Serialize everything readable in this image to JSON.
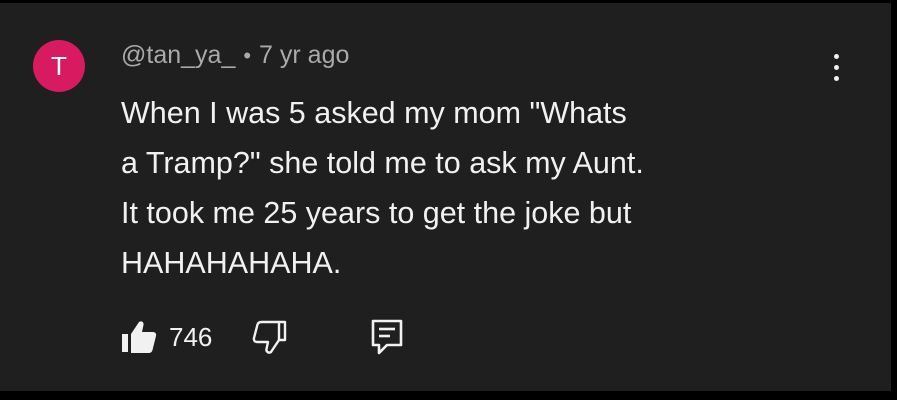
{
  "comment": {
    "avatar_letter": "T",
    "avatar_color": "#d81b60",
    "author": "@tan_ya_",
    "separator": "•",
    "time": "7 yr ago",
    "text_lines": [
      "When I was 5 asked my mom \"Whats",
      "a Tramp?\" she told me to ask my Aunt.",
      "It took me 25 years to get the joke but",
      "HAHAHAHAHA."
    ],
    "like_count": "746",
    "icons": {
      "like": "thumbs-up-icon",
      "dislike": "thumbs-down-icon",
      "reply": "reply-comment-icon",
      "menu": "more-vertical-icon"
    }
  },
  "colors": {
    "background": "#1f1f1f",
    "frame": "#000000",
    "text": "#f1f1f1",
    "meta": "#aaaaaa"
  }
}
